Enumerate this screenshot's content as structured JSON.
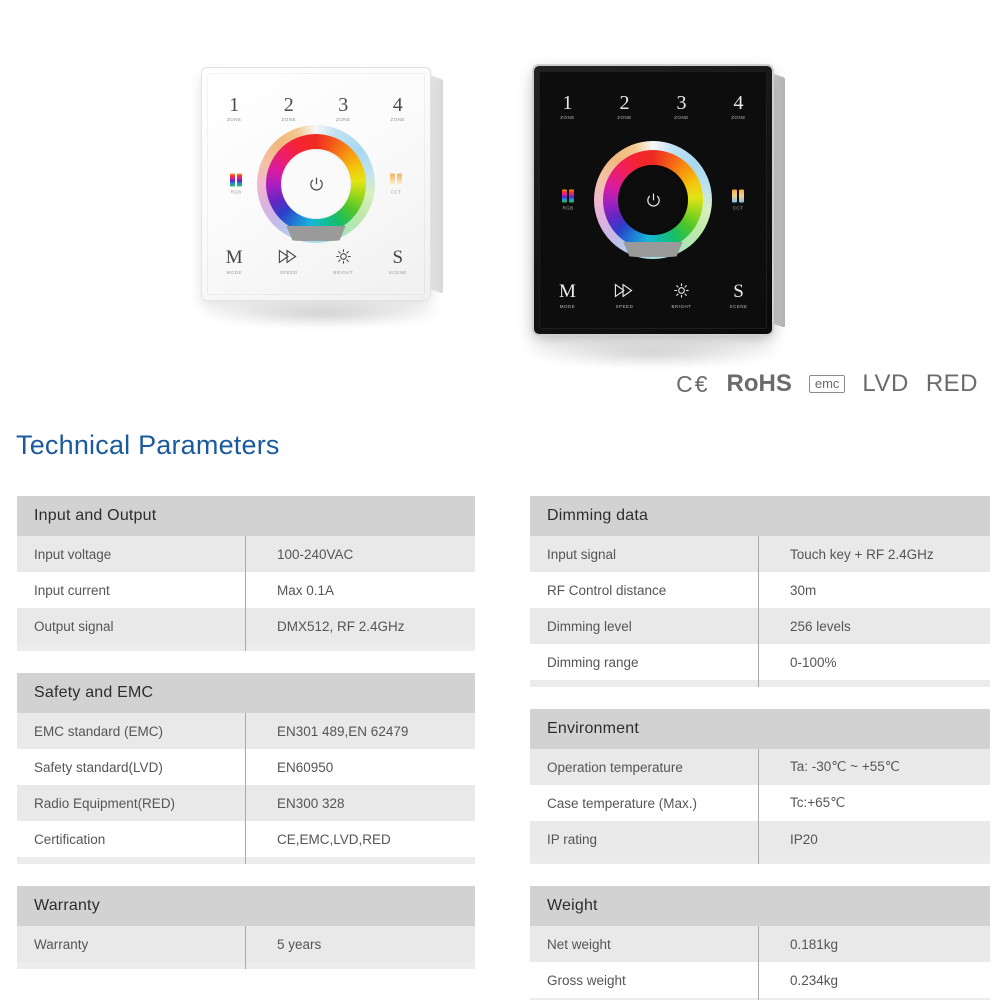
{
  "heading": "Technical Parameters",
  "certifications": [
    {
      "name": "ce-mark",
      "label": "C€",
      "style": "ce"
    },
    {
      "name": "rohs-mark",
      "label": "RoHS",
      "style": "rohs"
    },
    {
      "name": "emc-mark",
      "label": "emc",
      "style": "emc"
    },
    {
      "name": "lvd-mark",
      "label": "LVD",
      "style": "plain"
    },
    {
      "name": "red-mark",
      "label": "RED",
      "style": "plain"
    }
  ],
  "panels": {
    "white": {
      "variant": "White touch panel controller",
      "zones": [
        {
          "num": "1",
          "sub": "ZONE"
        },
        {
          "num": "2",
          "sub": "ZONE"
        },
        {
          "num": "3",
          "sub": "ZONE"
        },
        {
          "num": "4",
          "sub": "ZONE"
        }
      ],
      "left_icon": "RGB",
      "right_icon": "CCT",
      "power": "power-icon",
      "keys": [
        {
          "glyph": "M",
          "cap": "MODE"
        },
        {
          "glyph": "speed-icon",
          "cap": "SPEED"
        },
        {
          "glyph": "brightness-icon",
          "cap": "BRIGHT"
        },
        {
          "glyph": "S",
          "cap": "SCENE"
        }
      ]
    },
    "black": {
      "variant": "Black touch panel controller",
      "zones": [
        {
          "num": "1",
          "sub": "ZONE"
        },
        {
          "num": "2",
          "sub": "ZONE"
        },
        {
          "num": "3",
          "sub": "ZONE"
        },
        {
          "num": "4",
          "sub": "ZONE"
        }
      ],
      "left_icon": "RGB",
      "right_icon": "CCT",
      "power": "power-icon",
      "keys": [
        {
          "glyph": "M",
          "cap": "MODE"
        },
        {
          "glyph": "speed-icon",
          "cap": "SPEED"
        },
        {
          "glyph": "brightness-icon",
          "cap": "BRIGHT"
        },
        {
          "glyph": "S",
          "cap": "SCENE"
        }
      ]
    }
  },
  "colors": {
    "heading_blue": "#1b5a9e",
    "section_header_gray": "#d2d2d2",
    "row_alt_gray": "#e9e9e9",
    "divider_gray": "#a9a9a9",
    "text_gray": "#555555"
  },
  "tables": {
    "left": [
      {
        "title": "Input and Output",
        "rows": [
          {
            "key": "Input voltage",
            "value": "100-240VAC"
          },
          {
            "key": "Input current",
            "value": "Max 0.1A"
          },
          {
            "key": "Output signal",
            "value": "DMX512, RF 2.4GHz"
          }
        ]
      },
      {
        "title": "Safety and EMC",
        "rows": [
          {
            "key": "EMC standard (EMC)",
            "value": "EN301 489,EN 62479"
          },
          {
            "key": "Safety standard(LVD)",
            "value": "EN60950"
          },
          {
            "key": "Radio Equipment(RED)",
            "value": "EN300 328"
          },
          {
            "key": "Certification",
            "value": "CE,EMC,LVD,RED"
          }
        ]
      },
      {
        "title": "Warranty",
        "rows": [
          {
            "key": "Warranty",
            "value": "5 years"
          }
        ]
      }
    ],
    "right": [
      {
        "title": "Dimming data",
        "rows": [
          {
            "key": "Input signal",
            "value": "Touch key + RF 2.4GHz"
          },
          {
            "key": "RF Control distance",
            "value": "30m"
          },
          {
            "key": "Dimming level",
            "value": "256 levels"
          },
          {
            "key": "Dimming range",
            "value": "0-100%"
          }
        ]
      },
      {
        "title": "Environment",
        "rows": [
          {
            "key": "Operation temperature",
            "value": "Ta: -30℃ ~ +55℃"
          },
          {
            "key": "Case temperature (Max.)",
            "value": "Tc:+65℃"
          },
          {
            "key": "IP rating",
            "value": "IP20"
          }
        ]
      },
      {
        "title": "Weight",
        "rows": [
          {
            "key": "Net weight",
            "value": "0.181kg"
          },
          {
            "key": "Gross weight",
            "value": "0.234kg"
          }
        ]
      }
    ]
  }
}
